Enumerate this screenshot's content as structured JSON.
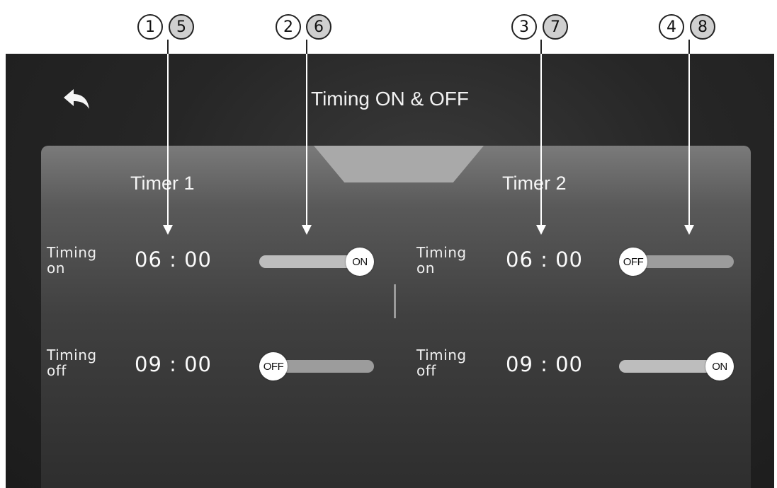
{
  "callouts": [
    {
      "a": "1",
      "b": "5"
    },
    {
      "a": "2",
      "b": "6"
    },
    {
      "a": "3",
      "b": "7"
    },
    {
      "a": "4",
      "b": "8"
    }
  ],
  "screen": {
    "title": "Timing ON & OFF",
    "back_icon": "back-arrow-icon"
  },
  "timers": [
    {
      "title": "Timer 1",
      "on_label": "Timing on",
      "on_label_line1": "Timing",
      "on_label_line2": "on",
      "on_time": "06:00",
      "on_time_display": "06 : 00",
      "on_state": "ON",
      "off_label": "Timing off",
      "off_label_line1": "Timing",
      "off_label_line2": "off",
      "off_time": "09:00",
      "off_time_display": "09 : 00",
      "off_state": "OFF"
    },
    {
      "title": "Timer 2",
      "on_label": "Timing on",
      "on_label_line1": "Timing",
      "on_label_line2": "on",
      "on_time": "06:00",
      "on_time_display": "06 : 00",
      "on_state": "OFF",
      "off_label": "Timing off",
      "off_label_line1": "Timing",
      "off_label_line2": "off",
      "off_time": "09:00",
      "off_time_display": "09 : 00",
      "off_state": "ON"
    }
  ]
}
